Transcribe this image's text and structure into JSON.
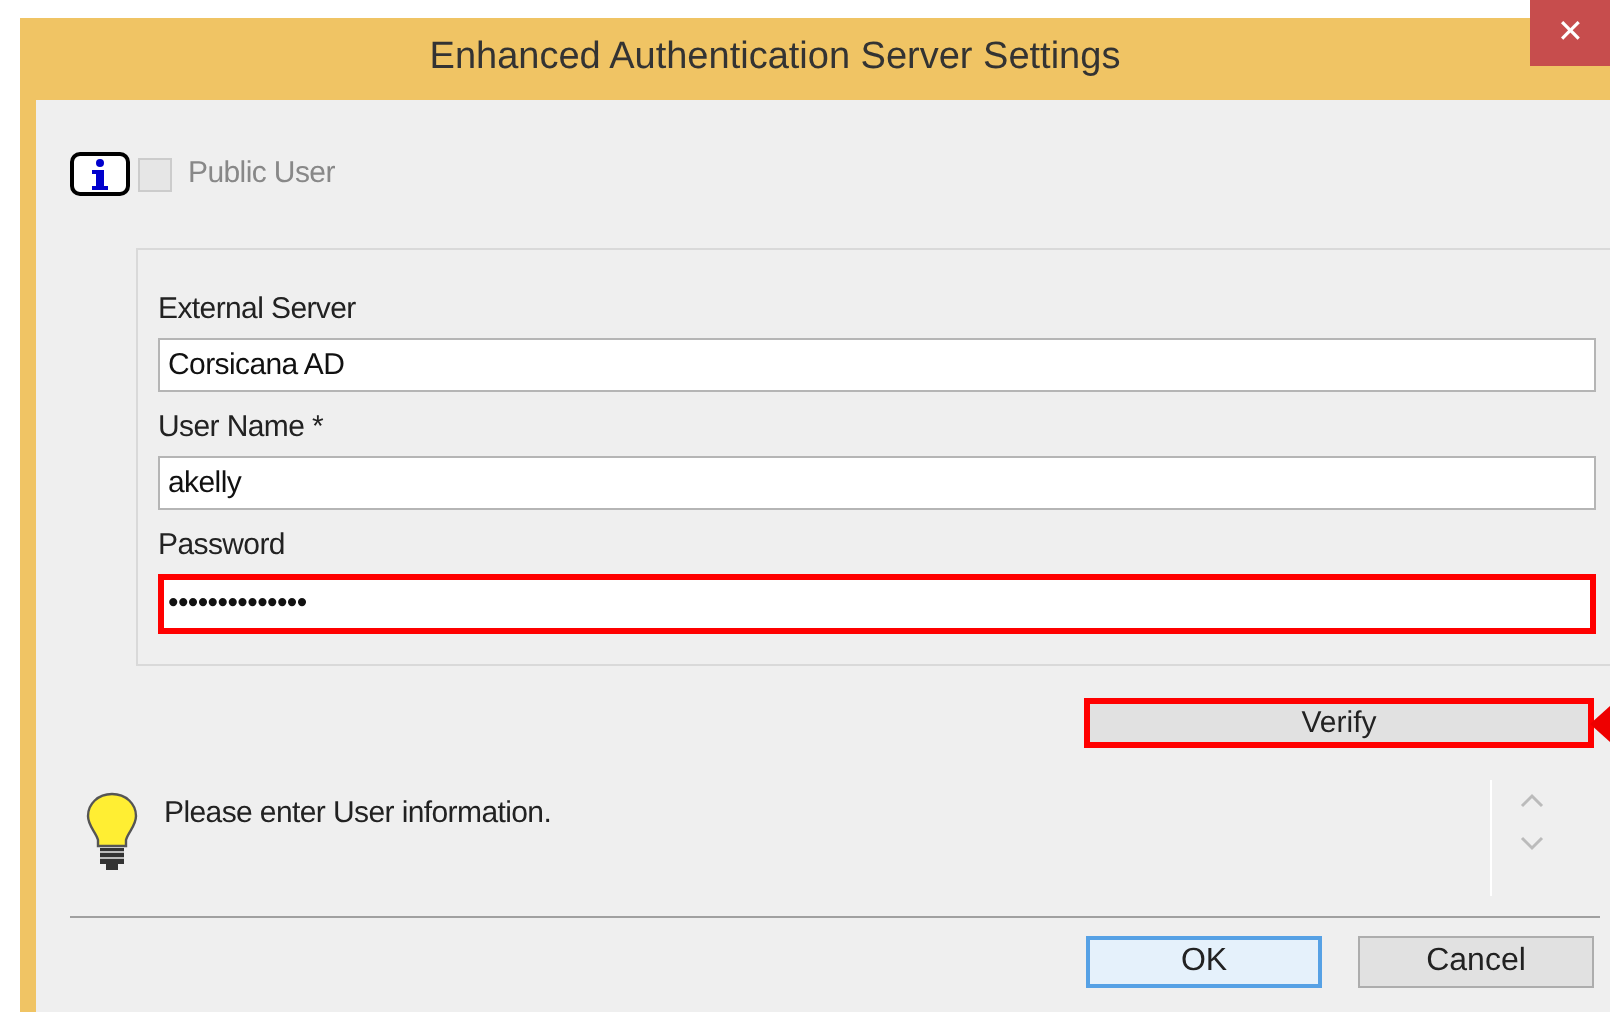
{
  "window": {
    "title": "Enhanced Authentication Server Settings",
    "close_glyph": "✕"
  },
  "public_user": {
    "label": "Public User",
    "checked": false,
    "disabled": true
  },
  "fields": [
    {
      "label": "External Server",
      "value": "Corsicana AD",
      "highlighted": false
    },
    {
      "label": "User Name *",
      "value": "akelly",
      "highlighted": false
    },
    {
      "label": "Password",
      "value": "••••••••••••••",
      "highlighted": true
    }
  ],
  "verify_button": {
    "label": "Verify",
    "highlighted": true
  },
  "message": "Please enter User information.",
  "buttons": [
    {
      "label": "OK",
      "selected": true
    },
    {
      "label": "Cancel",
      "selected": false
    }
  ]
}
